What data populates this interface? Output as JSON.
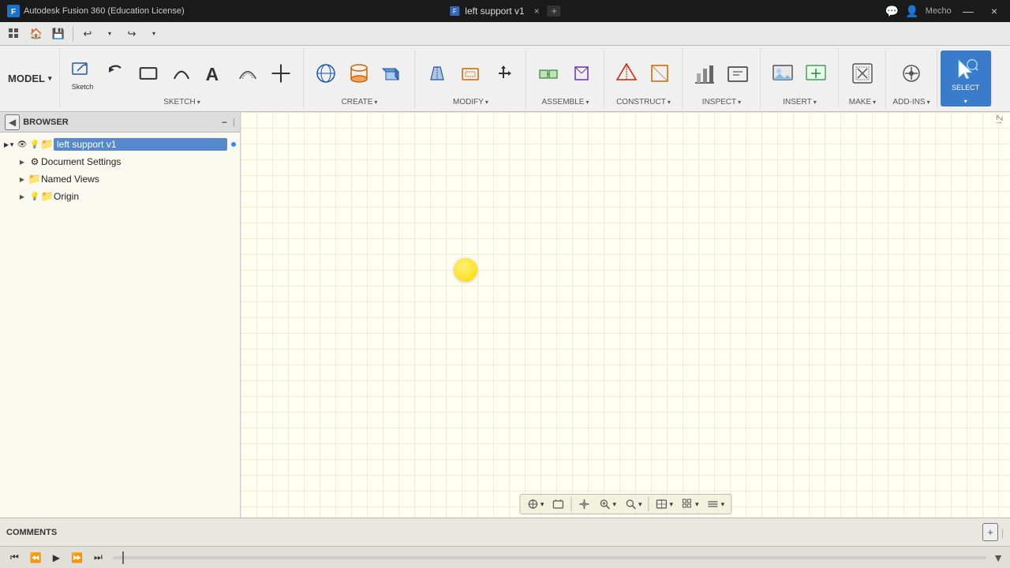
{
  "app": {
    "title": "Autodesk Fusion 360 (Education License)",
    "tab_title": "left support v1",
    "tab_close": "×",
    "new_tab": "+",
    "account": "Mecho",
    "minimize": "—",
    "close": "×"
  },
  "toolbar": {
    "model_label": "MODEL",
    "undo": "↩",
    "redo": "↪",
    "save": "💾",
    "grid_icon": "⊞",
    "home_icon": "⌂"
  },
  "ribbon": {
    "sketch": {
      "label": "SKETCH",
      "tools": [
        "sketch_icon",
        "undo_sketch",
        "rect",
        "arc",
        "text",
        "offset",
        "point"
      ]
    },
    "create": {
      "label": "CREATE"
    },
    "modify": {
      "label": "MODIFY"
    },
    "assemble": {
      "label": "ASSEMBLE"
    },
    "construct": {
      "label": "CONSTRUCT"
    },
    "inspect": {
      "label": "INSPECT"
    },
    "insert": {
      "label": "INSERT"
    },
    "make": {
      "label": "MAKE"
    },
    "add_ins": {
      "label": "ADD-INS"
    },
    "select": {
      "label": "SELECT"
    }
  },
  "browser": {
    "title": "BROWSER",
    "collapse_icon": "◀",
    "minus_icon": "−",
    "pipe_icon": "|",
    "items": [
      {
        "id": "root",
        "indent": 1,
        "expand": "open",
        "has_eye": true,
        "has_bulb": true,
        "has_folder": true,
        "label": "left support v1",
        "highlighted": true,
        "has_dot": true
      },
      {
        "id": "doc-settings",
        "indent": 2,
        "expand": "open",
        "has_eye": false,
        "has_gear": true,
        "label": "Document Settings",
        "highlighted": false
      },
      {
        "id": "named-views",
        "indent": 2,
        "expand": "open",
        "has_eye": false,
        "has_folder": true,
        "label": "Named Views",
        "highlighted": false
      },
      {
        "id": "origin",
        "indent": 2,
        "expand": "open",
        "has_eye": true,
        "has_folder": true,
        "label": "Origin",
        "highlighted": false
      }
    ]
  },
  "canvas": {
    "bg_color": "#fffff0",
    "axis_label": "Z↑"
  },
  "bottom_toolbar": {
    "buttons": [
      {
        "label": "⊕▾",
        "name": "joint-origin"
      },
      {
        "label": "⊡",
        "name": "capture-position"
      },
      {
        "label": "✋",
        "name": "pan"
      },
      {
        "label": "⊕▾",
        "name": "zoom-fit"
      },
      {
        "label": "🔍▾",
        "name": "zoom"
      },
      {
        "label": "▾",
        "name": "zoom-dropdown"
      },
      {
        "label": "⬜▾",
        "name": "display-mode"
      },
      {
        "label": "⊞▾",
        "name": "grid-snap"
      },
      {
        "label": "⊟▾",
        "name": "view-options"
      }
    ]
  },
  "comments": {
    "label": "COMMENTS",
    "add_icon": "+",
    "pipe_icon": "|"
  },
  "timeline": {
    "btn_first": "⏮",
    "btn_prev": "⏪",
    "btn_play": "▶",
    "btn_next": "⏩",
    "btn_last": "⏭",
    "marker_icon": "▼"
  }
}
